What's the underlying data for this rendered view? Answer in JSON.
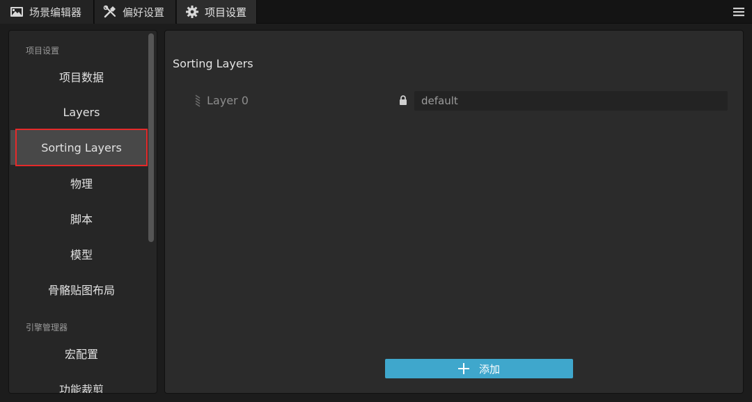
{
  "tabs": [
    {
      "label": "场景编辑器",
      "icon": "scene-editor-icon"
    },
    {
      "label": "偏好设置",
      "icon": "tools-icon"
    },
    {
      "label": "项目设置",
      "icon": "gear-icon",
      "active": true
    }
  ],
  "sidebar": {
    "sections": [
      {
        "label": "项目设置",
        "items": [
          "项目数据",
          "Layers",
          "Sorting Layers",
          "物理",
          "脚本",
          "模型",
          "骨骼贴图布局"
        ]
      },
      {
        "label": "引擎管理器",
        "items": [
          "宏配置",
          "功能裁剪"
        ]
      }
    ],
    "active_item": "Sorting Layers"
  },
  "main": {
    "title": "Sorting Layers",
    "layers": [
      {
        "name": "Layer 0",
        "value": "default",
        "locked": true
      }
    ],
    "add_button_label": "添加"
  },
  "colors": {
    "accent": "#3fa7cc",
    "highlight_border": "#e52a2a",
    "panel_bg": "#2b2b2b",
    "sidebar_bg": "#262626"
  }
}
